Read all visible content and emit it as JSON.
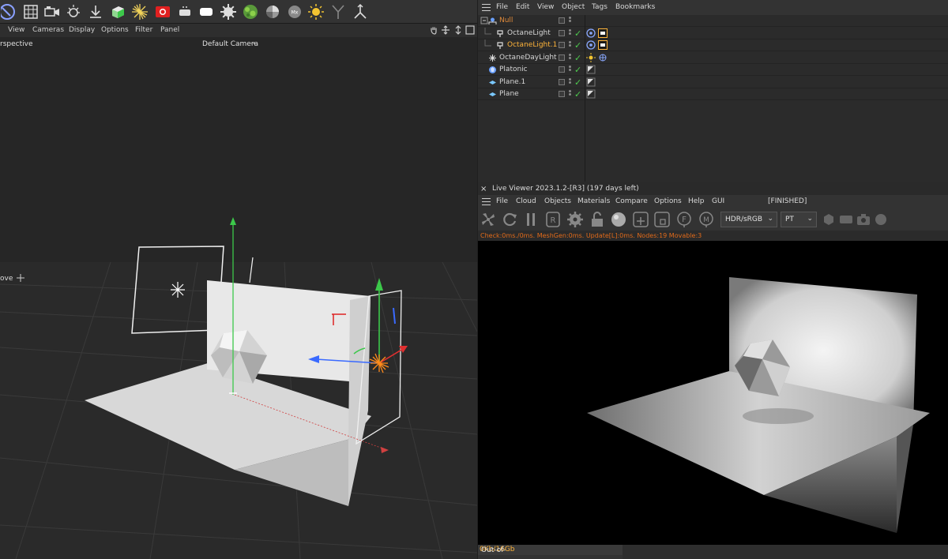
{
  "viewport": {
    "menu": [
      "View",
      "Cameras",
      "Display",
      "Options",
      "Filter",
      "Panel"
    ],
    "view_name": "rspective",
    "camera": "Default Camera",
    "camera_mark": "·•",
    "tool_label": "ove"
  },
  "toolbar_icons": [
    "cube-icon",
    "grid-icon",
    "camera-icon",
    "light-icon",
    "save-icon",
    "material-icon",
    "sun-burst-icon",
    "record-icon",
    "light-bulb-icon",
    "area-light-icon",
    "gear-icon",
    "vine-icon",
    "sphere-icon",
    "mix-icon",
    "sun-icon",
    "branch-icon",
    "joint-icon"
  ],
  "object_manager": {
    "menu": [
      "File",
      "Edit",
      "View",
      "Object",
      "Tags",
      "Bookmarks"
    ],
    "objects": [
      {
        "name": "Null",
        "type": "null",
        "selected": false,
        "orange": true
      },
      {
        "name": "OctaneLight",
        "type": "light",
        "selected": false
      },
      {
        "name": "OctaneLight.1",
        "type": "light",
        "selected": true
      },
      {
        "name": "OctaneDayLight",
        "type": "daylight",
        "selected": false
      },
      {
        "name": "Platonic",
        "type": "platonic",
        "selected": false
      },
      {
        "name": "Plane.1",
        "type": "plane",
        "selected": false
      },
      {
        "name": "Plane",
        "type": "plane",
        "selected": false
      }
    ]
  },
  "live_viewer": {
    "title": "Live Viewer 2023.1.2-[R3] (197 days left)",
    "close": "×",
    "menu": [
      "File",
      "Cloud",
      "Objects",
      "Materials",
      "Compare",
      "Options",
      "Help",
      "GUI"
    ],
    "status_tag": "[FINISHED]",
    "color_space": "HDR/sRGB",
    "kernel": "PT",
    "stats": "Check:0ms./0ms. MeshGen:0ms. Update[L]:0ms. Nodes:19 Movable:3",
    "out_of_core_label": "Out-of-core used/max:",
    "out_of_core_value": "0Kb/16Gb"
  },
  "colors": {
    "accent": "#ffb43a",
    "status": "#e06a1a",
    "check": "#4ec94e"
  }
}
